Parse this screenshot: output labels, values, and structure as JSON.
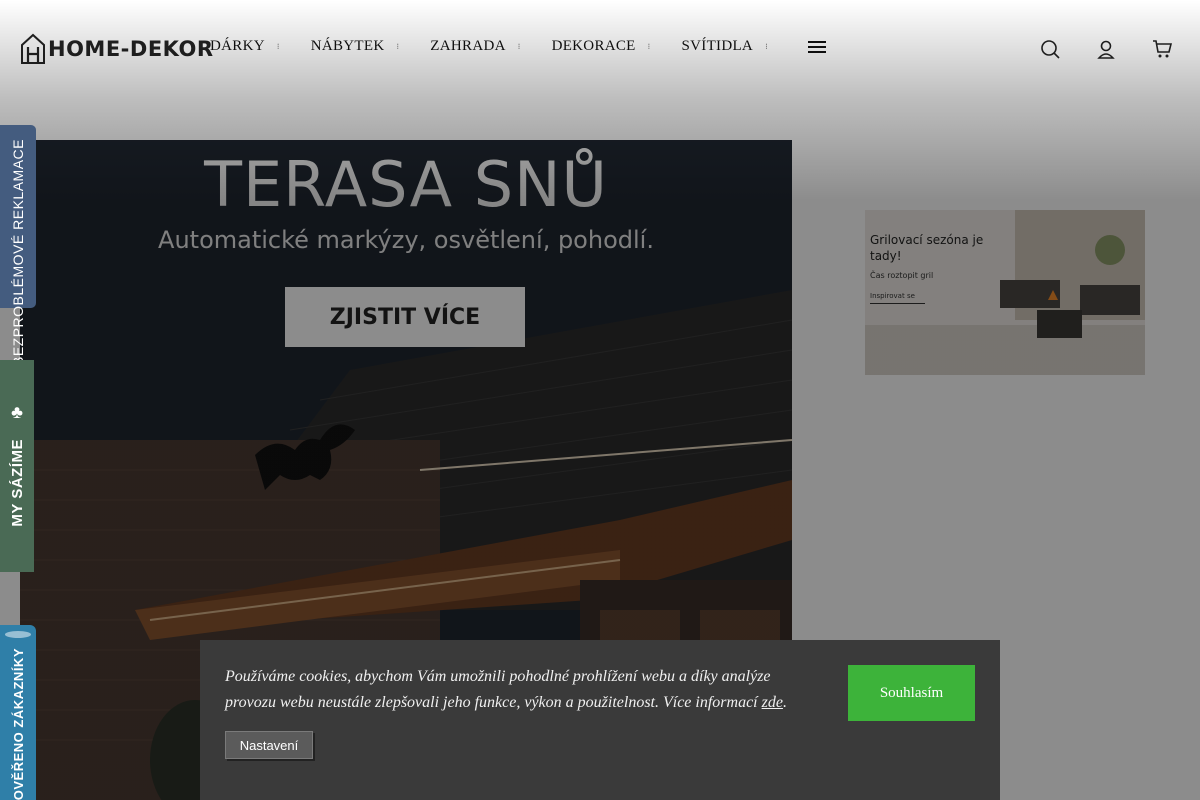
{
  "header": {
    "logo_text": "HOME-DEKOR",
    "nav": [
      {
        "label": "DÁRKY"
      },
      {
        "label": "NÁBYTEK"
      },
      {
        "label": "ZAHRADA"
      },
      {
        "label": "DEKORACE"
      },
      {
        "label": "SVÍTIDLA"
      }
    ],
    "icons": [
      "menu-icon",
      "search-icon",
      "user-icon",
      "cart-icon"
    ]
  },
  "hero": {
    "title": "TERASA SNŮ",
    "subtitle": "Automatické markýzy, osvětlení, pohodlí.",
    "cta_label": "ZJISTIT VÍCE"
  },
  "promo": {
    "title": "Grilovací sezóna je tady!",
    "subtitle": "Čas roztopit gril",
    "link_label": "Inspirovat se"
  },
  "side_tabs": {
    "reklamace": "BEZPROBLÉMOVÉ REKLAMACE",
    "sazime": "MY SÁZÍME",
    "overeno": "OVĚŘENO ZÁKAZNÍKY"
  },
  "cookie": {
    "text": "Používáme cookies, abychom Vám umožnili pohodlné prohlížení webu a díky analýze provozu webu neustále zlepšovali jeho funkce, výkon a použitelnost. Více informací",
    "link_label": "zde",
    "text_end": ".",
    "accept_label": "Souhlasím",
    "settings_label": "Nastavení"
  },
  "colors": {
    "accept_green": "#3db33a",
    "cookie_bg": "#3a3a3a",
    "tab_reklamace": "#445c7f",
    "tab_sazime": "#4a6a55",
    "tab_overeno": "#2f7fa8"
  }
}
